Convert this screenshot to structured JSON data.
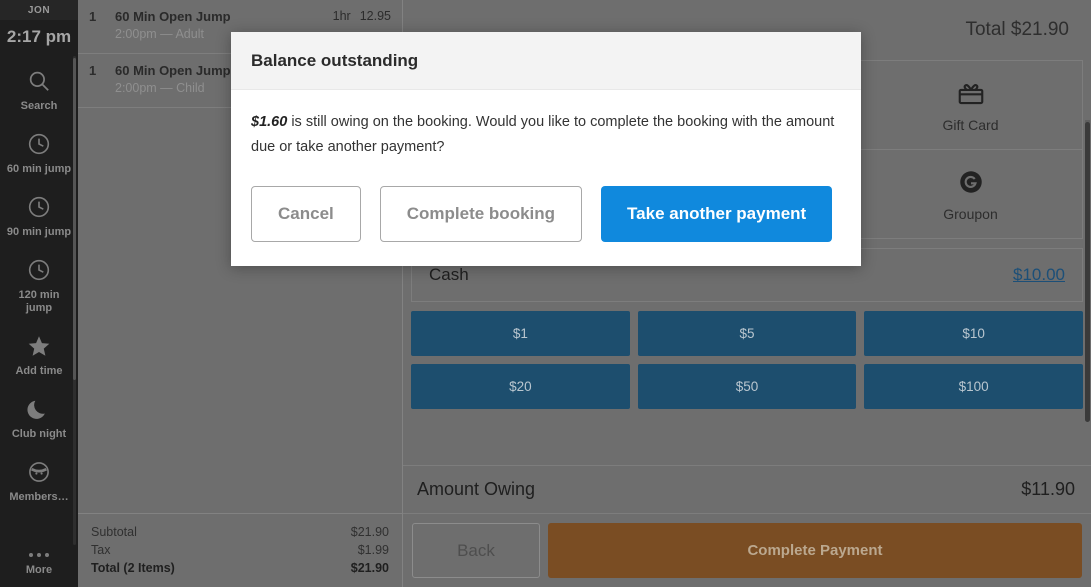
{
  "sidebar": {
    "user": "JON",
    "time": "2:17 pm",
    "items": [
      {
        "label": "Search",
        "icon": "search-icon"
      },
      {
        "label": "60 min jump",
        "icon": "clock-icon"
      },
      {
        "label": "90 min jump",
        "icon": "clock-icon"
      },
      {
        "label": "120 min jump",
        "icon": "clock-icon"
      },
      {
        "label": "Add time",
        "icon": "star-icon"
      },
      {
        "label": "Club night",
        "icon": "moon-icon"
      },
      {
        "label": "Members…",
        "icon": "member-face-icon"
      }
    ],
    "more_label": "More",
    "more_icon": "ellipsis-icon"
  },
  "cart": {
    "rows": [
      {
        "qty": "1",
        "name": "60 Min Open Jump",
        "sub": "2:00pm — Adult",
        "duration": "1hr",
        "price": "12.95"
      },
      {
        "qty": "1",
        "name": "60 Min Open Jump",
        "sub": "2:00pm — Child",
        "duration": "",
        "price": ""
      }
    ],
    "subtotal_label": "Subtotal",
    "subtotal_value": "$21.90",
    "tax_label": "Tax",
    "tax_value": "$1.99",
    "total_label": "Total (2 Items)",
    "total_value": "$21.90"
  },
  "payment": {
    "header_total": "Total $21.90",
    "tiles": [
      {
        "label": "Gift Card",
        "icon": "gift-card-icon"
      },
      {
        "label": "Groupon",
        "icon": "groupon-icon"
      }
    ],
    "cash_label": "Cash",
    "cash_value": "$10.00",
    "denominations": [
      "$1",
      "$5",
      "$10",
      "$20",
      "$50",
      "$100"
    ],
    "owing_label": "Amount Owing",
    "owing_value": "$11.90",
    "back_label": "Back",
    "complete_label": "Complete Payment",
    "accent_blue": "#1d4e6e",
    "accent_brown": "#7a4d23"
  },
  "modal": {
    "title": "Balance outstanding",
    "amount": "$1.60",
    "text_rest": " is still owing on the booking. Would you like to complete the booking with the amount due or take another payment?",
    "cancel_label": "Cancel",
    "complete_booking_label": "Complete booking",
    "take_payment_label": "Take another payment",
    "primary_color": "#1089dd"
  }
}
